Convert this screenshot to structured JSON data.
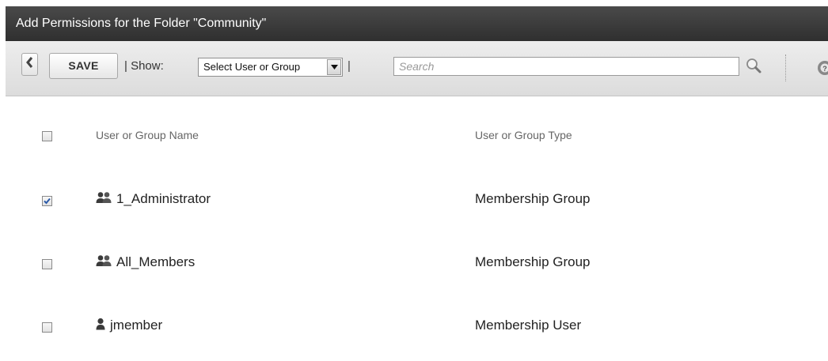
{
  "window": {
    "title": "Add Permissions for the Folder \"Community\""
  },
  "toolbar": {
    "back_icon": "chevron-left-icon",
    "save_label": "SAVE",
    "show_label": "| Show:",
    "show_select": {
      "value": "Select User or Group",
      "options": [
        "Select User or Group"
      ]
    },
    "separator": "|",
    "search": {
      "placeholder": "Search",
      "value": ""
    },
    "search_icon": "magnifier-icon",
    "help_icon": "help-icon"
  },
  "table": {
    "columns": [
      "User or Group Name",
      "User or Group Type"
    ],
    "rows": [
      {
        "name": "1_Administrator",
        "type": "Membership Group",
        "icon": "group-icon",
        "checked": true
      },
      {
        "name": "All_Members",
        "type": "Membership Group",
        "icon": "group-icon",
        "checked": false
      },
      {
        "name": "jmember",
        "type": "Membership User",
        "icon": "user-icon",
        "checked": false
      }
    ]
  }
}
